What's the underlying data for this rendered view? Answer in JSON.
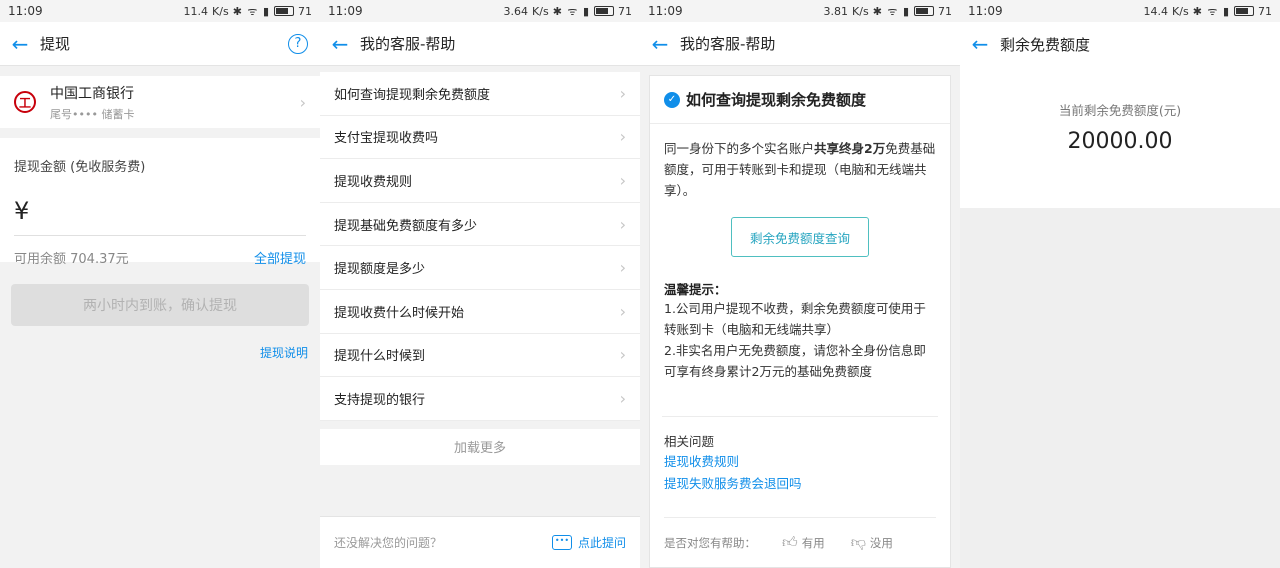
{
  "statusbars": [
    {
      "time": "11:09",
      "net": "11.4",
      "battery": "71"
    },
    {
      "time": "11:09",
      "net": "3.64",
      "battery": "71"
    },
    {
      "time": "11:09",
      "net": "3.81",
      "battery": "71"
    },
    {
      "time": "11:09",
      "net": "14.4",
      "battery": "71"
    }
  ],
  "status_unit": "K/s",
  "withdraw": {
    "title": "提现",
    "bank_name": "中国工商银行",
    "bank_sub": "尾号•••• 储蓄卡",
    "amount_label": "提现金额 (免收服务费)",
    "currency": "¥",
    "available": "可用余额 704.37元",
    "withdraw_all": "全部提现",
    "confirm_button": "两小时内到账，确认提现",
    "explain_link": "提现说明"
  },
  "help": {
    "title": "我的客服-帮助",
    "questions": [
      "如何查询提现剩余免费额度",
      "支付宝提现收费吗",
      "提现收费规则",
      "提现基础免费额度有多少",
      "提现额度是多少",
      "提现收费什么时候开始",
      "提现什么时候到",
      "支持提现的银行"
    ],
    "load_more": "加载更多",
    "unsolved": "还没解决您的问题？",
    "ask_link": "点此提问"
  },
  "answer": {
    "title": "我的客服-帮助",
    "question": "如何查询提现剩余免费额度",
    "body_pre": "同一身份下的多个实名账户",
    "body_bold": "共享终身2万",
    "body_post": "免费基础额度，可用于转账到卡和提现（电脑和无线端共享）。",
    "query_button": "剩余免费额度查询",
    "tips_title": "温馨提示：",
    "tip1": "1.公司用户提现不收费，剩余免费额度可使用于转账到卡（电脑和无线端共享）",
    "tip2": "2.非实名用户无免费额度，请您补全身份信息即可享有终身累计2万元的基础免费额度",
    "related_title": "相关问题",
    "related": [
      "提现收费规则",
      "提现失败服务费会退回吗"
    ],
    "feedback_q": "是否对您有帮助：",
    "useful": "有用",
    "useless": "没用"
  },
  "free_quota": {
    "title": "剩余免费额度",
    "label": "当前剩余免费额度(元)",
    "value": "20000.00"
  },
  "colors": {
    "accent": "#108ee9",
    "bank_red": "#c7000b"
  }
}
